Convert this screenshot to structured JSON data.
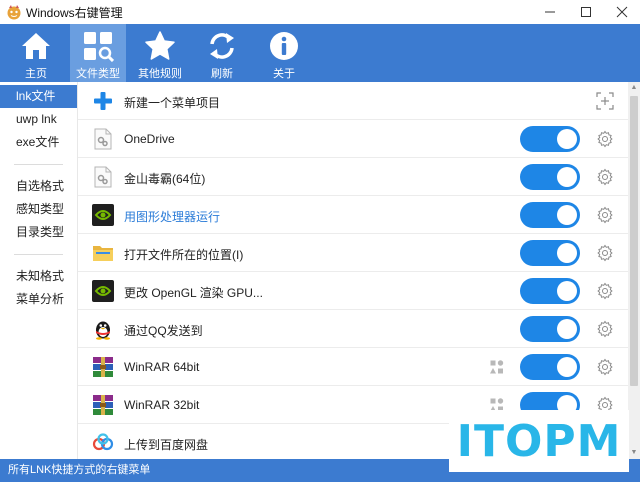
{
  "window": {
    "title": "Windows右键管理",
    "brand_color": "#3c7bd0",
    "toggle_color": "#1e86e6"
  },
  "toolbar": {
    "items": [
      {
        "label": "主页",
        "icon": "home-icon"
      },
      {
        "label": "文件类型",
        "icon": "file-type-icon",
        "active": true
      },
      {
        "label": "其他规则",
        "icon": "star-icon"
      },
      {
        "label": "刷新",
        "icon": "refresh-icon"
      },
      {
        "label": "关于",
        "icon": "info-icon"
      }
    ]
  },
  "sidebar": {
    "groups": [
      [
        "lnk文件",
        "uwp lnk",
        "exe文件"
      ],
      [
        "自选格式",
        "感知类型",
        "目录类型"
      ],
      [
        "未知格式",
        "菜单分析"
      ]
    ],
    "active": "lnk文件"
  },
  "list": {
    "new_item_label": "新建一个菜单项目",
    "items": [
      {
        "label": "OneDrive",
        "icon": "generic-app-icon",
        "enabled": true
      },
      {
        "label": "金山毒霸(64位)",
        "icon": "generic-app-icon",
        "enabled": true
      },
      {
        "label": "用图形处理器运行",
        "icon": "nvidia-icon",
        "enabled": true,
        "highlighted": true
      },
      {
        "label": "打开文件所在的位置(I)",
        "icon": "folder-icon",
        "enabled": true
      },
      {
        "label": "更改 OpenGL 渲染 GPU...",
        "icon": "nvidia-icon",
        "enabled": true
      },
      {
        "label": "通过QQ发送到",
        "icon": "qq-penguin-icon",
        "enabled": true
      },
      {
        "label": "WinRAR 64bit",
        "icon": "winrar-icon",
        "enabled": true,
        "shapes": true
      },
      {
        "label": "WinRAR 32bit",
        "icon": "winrar-icon",
        "enabled": true,
        "shapes": true
      },
      {
        "label": "上传到百度网盘",
        "icon": "baidu-netdisk-icon",
        "enabled": true
      }
    ]
  },
  "statusbar": {
    "text": "所有LNK快捷方式的右键菜单"
  },
  "watermark": {
    "text": "ITOPM"
  }
}
